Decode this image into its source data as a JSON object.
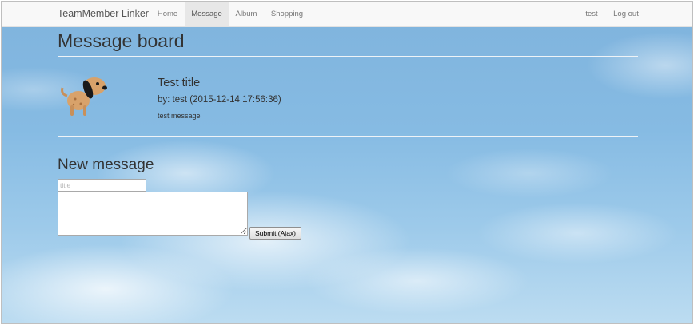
{
  "navbar": {
    "brand": "TeamMember Linker",
    "items": [
      {
        "label": "Home",
        "active": false
      },
      {
        "label": "Message",
        "active": true
      },
      {
        "label": "Album",
        "active": false
      },
      {
        "label": "Shopping",
        "active": false
      }
    ],
    "user": "test",
    "logout": "Log out"
  },
  "page": {
    "title": "Message board"
  },
  "messages": [
    {
      "avatar": "dog-icon",
      "title": "Test title",
      "byline": "by: test (2015-12-14 17:56:36)",
      "body": "test message"
    }
  ],
  "new_message": {
    "heading": "New message",
    "title_placeholder": "title",
    "title_value": "",
    "body_value": "",
    "submit_label": "Submit (Ajax)"
  },
  "colors": {
    "navbar_bg": "#f8f8f8",
    "active_tab_bg": "#e7e7e7",
    "sky": "#86bbe3",
    "avatar_fur": "#d8a26a",
    "avatar_ears": "#1a1a1a"
  }
}
